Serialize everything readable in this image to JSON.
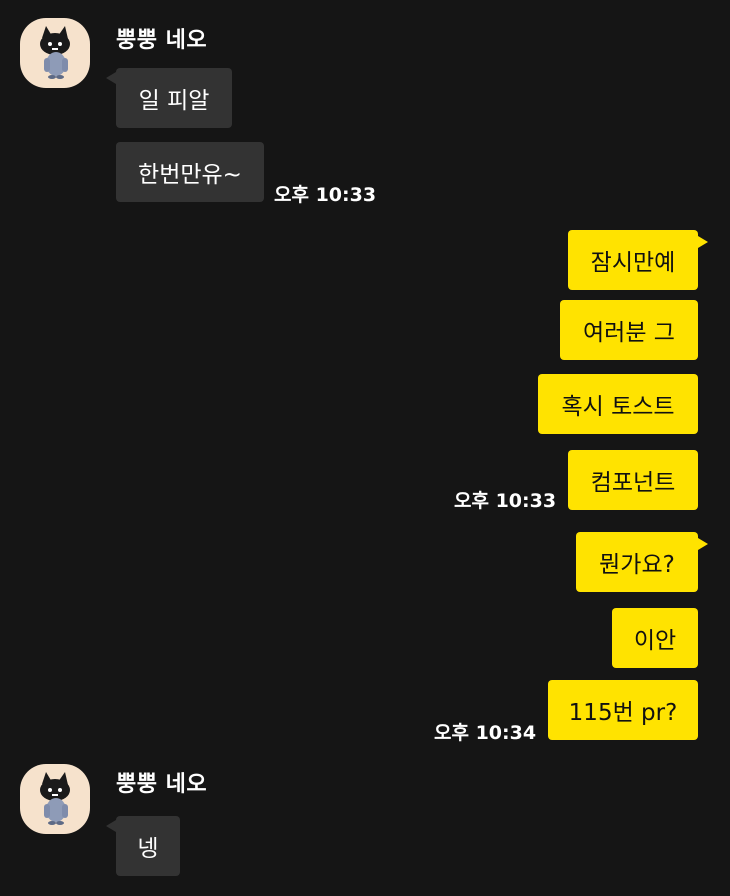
{
  "chat": {
    "sender_name": "뿡뿡 네오",
    "avatar_icon": "cat-character-avatar-icon",
    "colors": {
      "background": "#151515",
      "incoming_bubble": "#333333",
      "outgoing_bubble": "#ffe300",
      "avatar_bg": "#f6e2cc"
    },
    "group1": {
      "messages": [
        "일 피알",
        "한번만유~"
      ],
      "time": "오후 10:33"
    },
    "group2": {
      "messages": [
        "잠시만예",
        "여러분 그",
        "혹시 토스트",
        "컴포넌트"
      ],
      "time": "오후 10:33"
    },
    "group3": {
      "messages": [
        "뭔가요?",
        "이안",
        "115번 pr?"
      ],
      "time": "오후 10:34"
    },
    "group4": {
      "messages": [
        "넹"
      ]
    }
  }
}
